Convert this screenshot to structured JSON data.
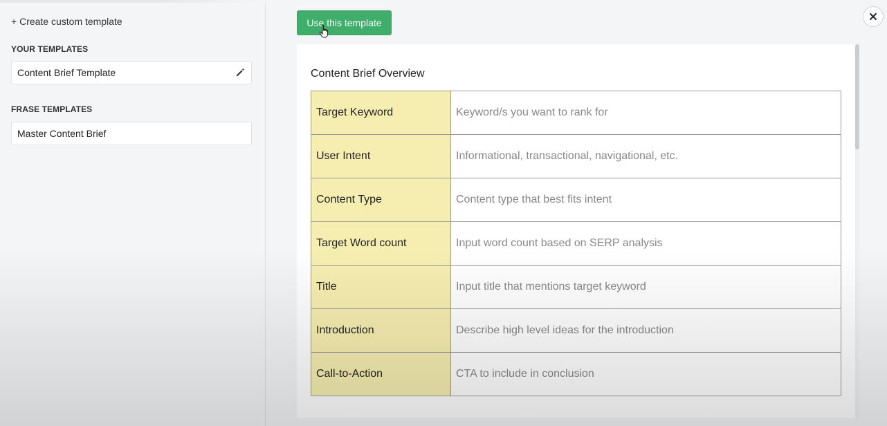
{
  "sidebar": {
    "create_label": "+ Create custom template",
    "your_templates_heading": "YOUR TEMPLATES",
    "your_templates": [
      {
        "label": "Content Brief Template",
        "icon": "pencil-icon"
      }
    ],
    "frase_templates_heading": "FRASE TEMPLATES",
    "frase_templates": [
      {
        "label": "Master Content Brief"
      }
    ]
  },
  "main": {
    "use_button_label": "Use this template",
    "close_icon": "close-icon",
    "doc_title": "Content Brief Overview",
    "rows": [
      {
        "key": "Target Keyword",
        "value": "Keyword/s you want to rank for"
      },
      {
        "key": "User Intent",
        "value": "Informational, transactional, navigational, etc."
      },
      {
        "key": "Content Type",
        "value": "Content type that best fits intent"
      },
      {
        "key": "Target Word count",
        "value": "Input word count based on SERP analysis"
      },
      {
        "key": "Title",
        "value": "Input title that mentions target keyword"
      },
      {
        "key": "Introduction",
        "value": "Describe high level ideas for the introduction"
      },
      {
        "key": "Call-to-Action",
        "value": "CTA to include in conclusion"
      }
    ]
  },
  "colors": {
    "button_green": "#3fae6a",
    "key_cell_yellow": "#f6eeb1",
    "value_text_gray": "#888888"
  }
}
